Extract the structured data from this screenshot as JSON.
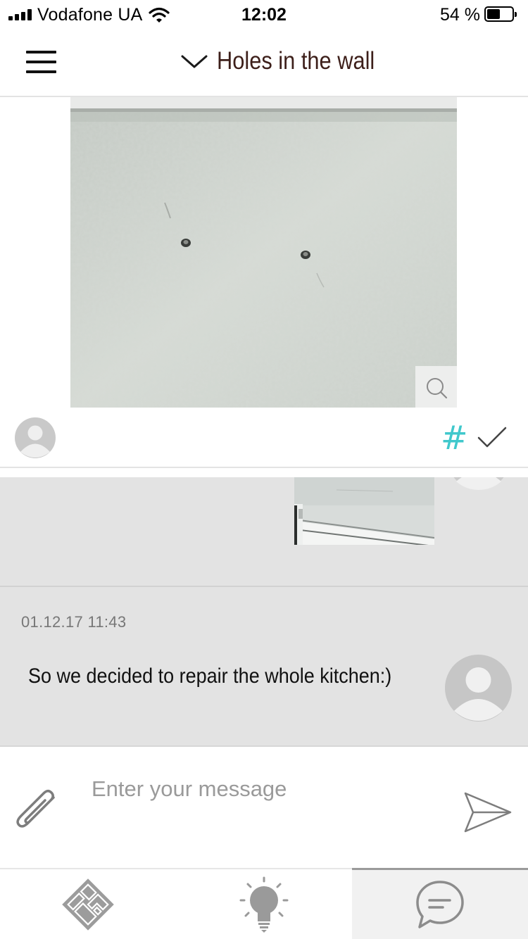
{
  "status_bar": {
    "carrier": "Vodafone UA",
    "time": "12:02",
    "battery_percent": "54 %",
    "battery_level": 0.54
  },
  "header": {
    "title": "Holes in the wall",
    "title_color": "#3d1f1a"
  },
  "post": {
    "image_description": "white textured wall with two small screw holes",
    "icons": [
      "zoom-icon",
      "hash-icon",
      "check-icon",
      "avatar-placeholder"
    ],
    "hash_color": "#40c8cc"
  },
  "chat": {
    "messages": [
      {
        "timestamp": "01.12.17 11:43",
        "text": "So we decided to repair the whole kitchen:)"
      }
    ],
    "background": "#e3e3e3"
  },
  "composer": {
    "placeholder": "Enter your message"
  },
  "tab_bar": {
    "tabs": [
      {
        "name": "plan",
        "icon": "floor-plan-icon",
        "active": false
      },
      {
        "name": "ideas",
        "icon": "lightbulb-icon",
        "active": false
      },
      {
        "name": "chat",
        "icon": "chat-bubble-icon",
        "active": true
      }
    ]
  }
}
